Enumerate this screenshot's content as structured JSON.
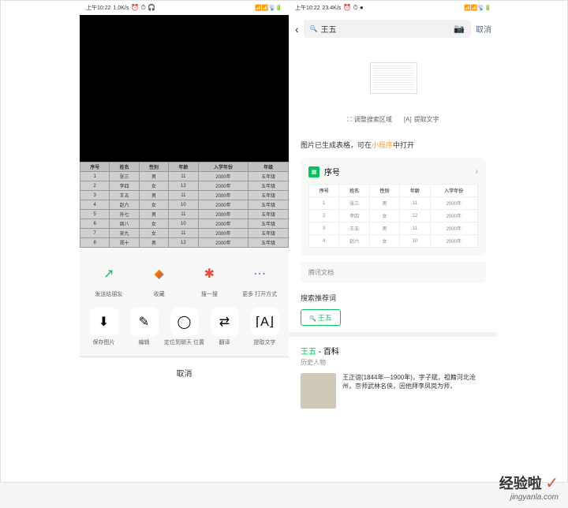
{
  "left": {
    "status": {
      "time": "上午10:22",
      "net": "1.0K/s",
      "icons": "⏰ ⏱ 🎧"
    },
    "table": {
      "headers": [
        "序号",
        "姓名",
        "性别",
        "年龄",
        "入学年份",
        "年级"
      ],
      "rows": [
        [
          "1",
          "张三",
          "男",
          "11",
          "2000年",
          "五年级"
        ],
        [
          "2",
          "李四",
          "女",
          "12",
          "2000年",
          "五年级"
        ],
        [
          "3",
          "王五",
          "男",
          "11",
          "2000年",
          "五年级"
        ],
        [
          "4",
          "赵六",
          "女",
          "10",
          "2000年",
          "五年级"
        ],
        [
          "5",
          "孙七",
          "男",
          "11",
          "2000年",
          "五年级"
        ],
        [
          "6",
          "周八",
          "女",
          "10",
          "2000年",
          "五年级"
        ],
        [
          "7",
          "吴九",
          "女",
          "11",
          "2000年",
          "五年级"
        ],
        [
          "8",
          "郑十",
          "男",
          "12",
          "2000年",
          "五年级"
        ]
      ]
    },
    "share_row1": [
      {
        "label": "发送给朋友",
        "icon": "↗"
      },
      {
        "label": "收藏",
        "icon": "◆"
      },
      {
        "label": "搜一搜",
        "icon": "✱"
      },
      {
        "label": "更多\n打开方式",
        "icon": "⋯"
      }
    ],
    "share_row2": [
      {
        "label": "保存图片",
        "icon": "⬇"
      },
      {
        "label": "编辑",
        "icon": "✎"
      },
      {
        "label": "定位到聊天\n位置",
        "icon": "◯"
      },
      {
        "label": "翻译",
        "icon": "⇄"
      },
      {
        "label": "提取文字",
        "icon": "⌈A⌋"
      }
    ],
    "cancel": "取消"
  },
  "right": {
    "status": {
      "time": "上午10:22",
      "net": "23.4K/s",
      "icons": "⏰ ⏱ ●"
    },
    "search": {
      "query": "王五",
      "cancel": "取消"
    },
    "actions": {
      "crop": "调整搜索区域",
      "extract": "提取文字"
    },
    "notice_pre": "图片已生成表格，可在",
    "notice_link": "小程序",
    "notice_post": "中打开",
    "doc": {
      "title": "序号",
      "headers": [
        "序号",
        "姓名",
        "性别",
        "年龄",
        "入学年份"
      ],
      "rows": [
        [
          "1",
          "张三",
          "男",
          "11",
          "2000年"
        ],
        [
          "2",
          "李四",
          "女",
          "12",
          "2000年"
        ],
        [
          "3",
          "王五",
          "男",
          "11",
          "2000年"
        ],
        [
          "4",
          "赵六",
          "女",
          "10",
          "2000年"
        ]
      ],
      "source": "腾讯文档"
    },
    "recommend": {
      "title": "搜索推荐词",
      "tag": "王五"
    },
    "baike": {
      "name": "王五",
      "suffix": " - 百科",
      "sub": "历史人物",
      "text": "王正谊(1844年—1900年)，字子斌，祖籍河北沧州，京师武林名侠，因他拜李凤岗为师，"
    }
  },
  "watermark": {
    "main": "经验啦",
    "sub": "jingyanla.com"
  }
}
